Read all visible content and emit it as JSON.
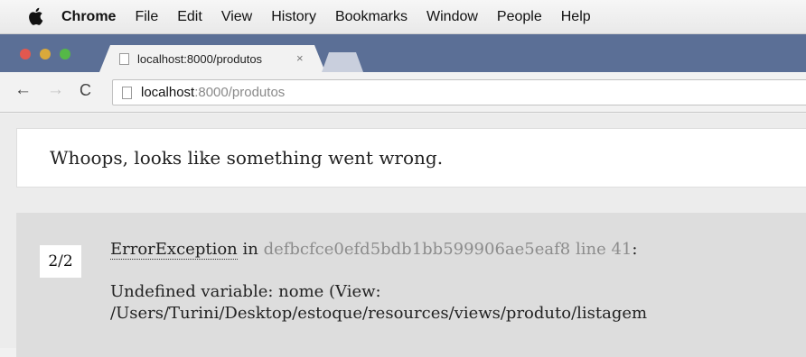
{
  "menubar": {
    "app_name": "Chrome",
    "items": [
      "File",
      "Edit",
      "View",
      "History",
      "Bookmarks",
      "Window",
      "People",
      "Help"
    ]
  },
  "tab": {
    "title": "localhost:8000/produtos",
    "close_glyph": "×"
  },
  "toolbar": {
    "back_glyph": "←",
    "forward_glyph": "→",
    "reload_glyph": "C",
    "url_host": "localhost",
    "url_rest": ":8000/produtos"
  },
  "page": {
    "header": "Whoops, looks like something went wrong.",
    "frame_counter": "2/2",
    "exception_class": "ErrorException",
    "in_word": " in ",
    "file_hash": "defbcfce0efd5bdb1bb599906ae5eaf8",
    "line_text": " line 41",
    "colon": ":",
    "message_line1": "Undefined variable: nome (View:",
    "message_line2": "/Users/Turini/Desktop/estoque/resources/views/produto/listagem"
  },
  "colors": {
    "tabstrip": "#5b6f96",
    "traffic_close": "#e2584f",
    "traffic_min": "#d9a93b",
    "traffic_max": "#55b847"
  }
}
